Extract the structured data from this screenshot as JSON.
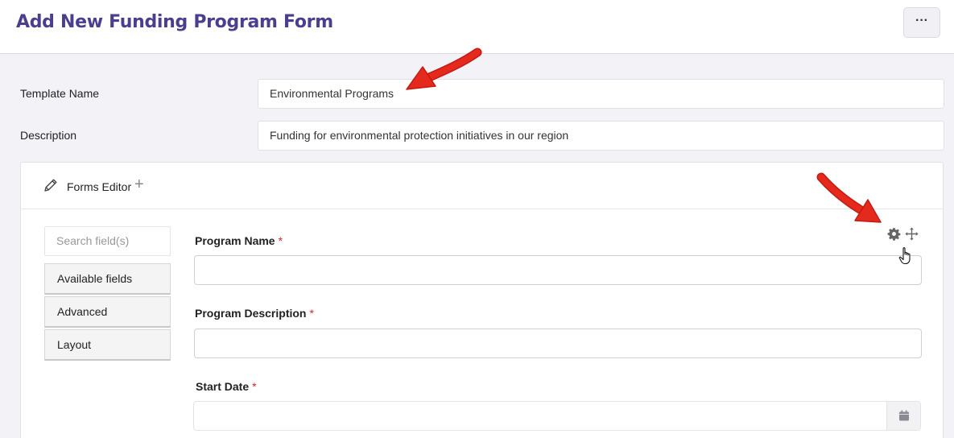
{
  "header": {
    "title": "Add New Funding Program Form",
    "more_label": "···"
  },
  "template": {
    "name_label": "Template Name",
    "name_value": "Environmental Programs",
    "description_label": "Description",
    "description_value": "Funding for environmental protection initiatives in our region"
  },
  "editor": {
    "title": "Forms Editor",
    "add_icon": "plus-icon",
    "search_placeholder": "Search field(s)",
    "side_buttons": [
      "Available fields",
      "Advanced",
      "Layout"
    ],
    "fields": [
      {
        "label": "Program Name",
        "required_mark": "*"
      },
      {
        "label": "Program Description",
        "required_mark": "*"
      },
      {
        "label": "Start Date",
        "required_mark": "*"
      }
    ],
    "icons": [
      "gear-icon",
      "move-icon",
      "calendar-icon",
      "pencil-icon"
    ]
  },
  "colors": {
    "title": "#4b3e8f",
    "required": "#d9242e",
    "annotation_arrow": "#e0261b",
    "background": "#f2f2f7"
  }
}
